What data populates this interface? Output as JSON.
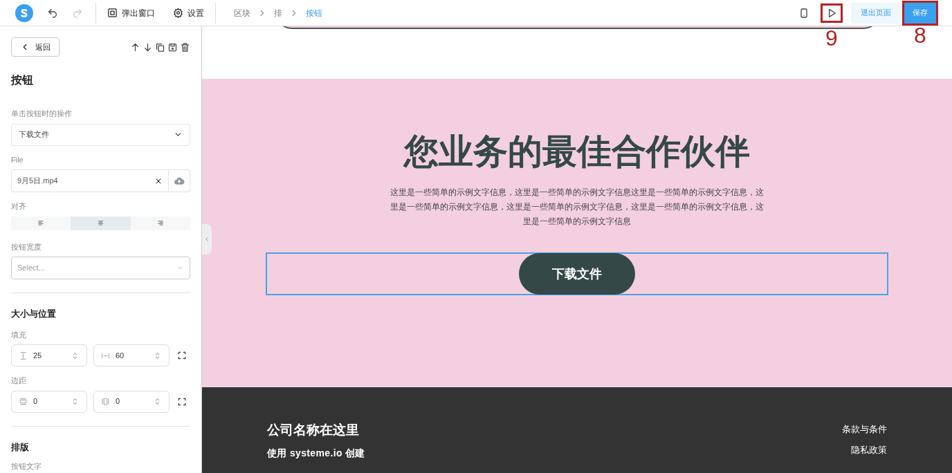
{
  "toolbar": {
    "items": [
      {
        "kind": "popup",
        "label": "弹出窗口"
      },
      {
        "kind": "settings",
        "label": "设置"
      }
    ],
    "breadcrumb": [
      {
        "label": "区块",
        "selected": false
      },
      {
        "label": "排",
        "selected": false
      },
      {
        "label": "按钮",
        "selected": true
      }
    ],
    "exit_label": "退出页面",
    "save_label": "保存",
    "preview_annotation": "9",
    "save_annotation": "8"
  },
  "sidebar": {
    "back_label": "返回",
    "title": "按钮",
    "action": {
      "label": "单击按钮时的操作",
      "value": "下载文件"
    },
    "file": {
      "label": "File",
      "value": "9月5日.mp4"
    },
    "align": {
      "label": "对齐",
      "options": [
        {
          "kind": "left",
          "selected": false
        },
        {
          "kind": "center",
          "selected": true
        },
        {
          "kind": "right",
          "selected": false
        }
      ]
    },
    "width": {
      "label": "按钮宽度",
      "placeholder": "Select..."
    },
    "size_section": "大小与位置",
    "padding": {
      "label": "填充",
      "vertical": "25",
      "horizontal": "60"
    },
    "margin": {
      "label": "边距",
      "vertical": "0",
      "horizontal": "0"
    },
    "type_section": "排版",
    "button_text_label": "按钮文字"
  },
  "canvas": {
    "headline": "您业务的最佳合作伙伴",
    "body": "这里是一些简单的示例文字信息，这里是一些简单的示例文字信息这里是一些简单的示例文字信息，这里是一些简单的示例文字信息，这里是一些简单的示例文字信息，这里是一些简单的示例文字信息，这里是一些简单的示例文字信息",
    "button": "下载文件",
    "footer": {
      "company": "公司名称在这里",
      "made_with": "使用 systeme.io 创建",
      "links": [
        "条款与条件",
        "隐私政策"
      ]
    }
  }
}
